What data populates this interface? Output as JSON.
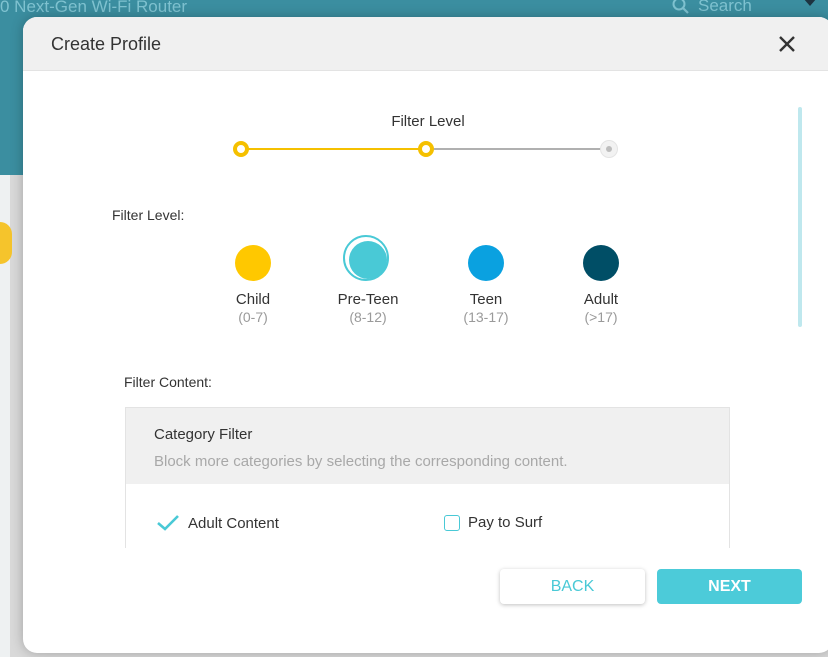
{
  "background": {
    "title": "0 Next-Gen Wi-Fi Router",
    "search_label": "Search"
  },
  "modal": {
    "title": "Create Profile",
    "close_icon": "close-icon"
  },
  "stepper": {
    "label": "Filter Level",
    "current_step": 2,
    "total_steps": 3
  },
  "filter_level": {
    "label": "Filter Level:",
    "options": [
      {
        "name": "Child",
        "range": "(0-7)",
        "color": "#ffc800"
      },
      {
        "name": "Pre-Teen",
        "range": "(8-12)",
        "color": "#49c9d6",
        "selected": true
      },
      {
        "name": "Teen",
        "range": "(13-17)",
        "color": "#0aa1e0"
      },
      {
        "name": "Adult",
        "range": "(>17)",
        "color": "#004e66"
      }
    ]
  },
  "filter_content": {
    "label": "Filter Content:",
    "category_title": "Category Filter",
    "category_desc": "Block more categories by selecting the corresponding content.",
    "items": [
      {
        "label": "Adult Content",
        "checked": true
      },
      {
        "label": "Pay to Surf",
        "checked": false
      }
    ]
  },
  "buttons": {
    "back": "BACK",
    "next": "NEXT"
  },
  "colors": {
    "accent": "#49c9d6",
    "stepper_done": "#f5c000"
  }
}
